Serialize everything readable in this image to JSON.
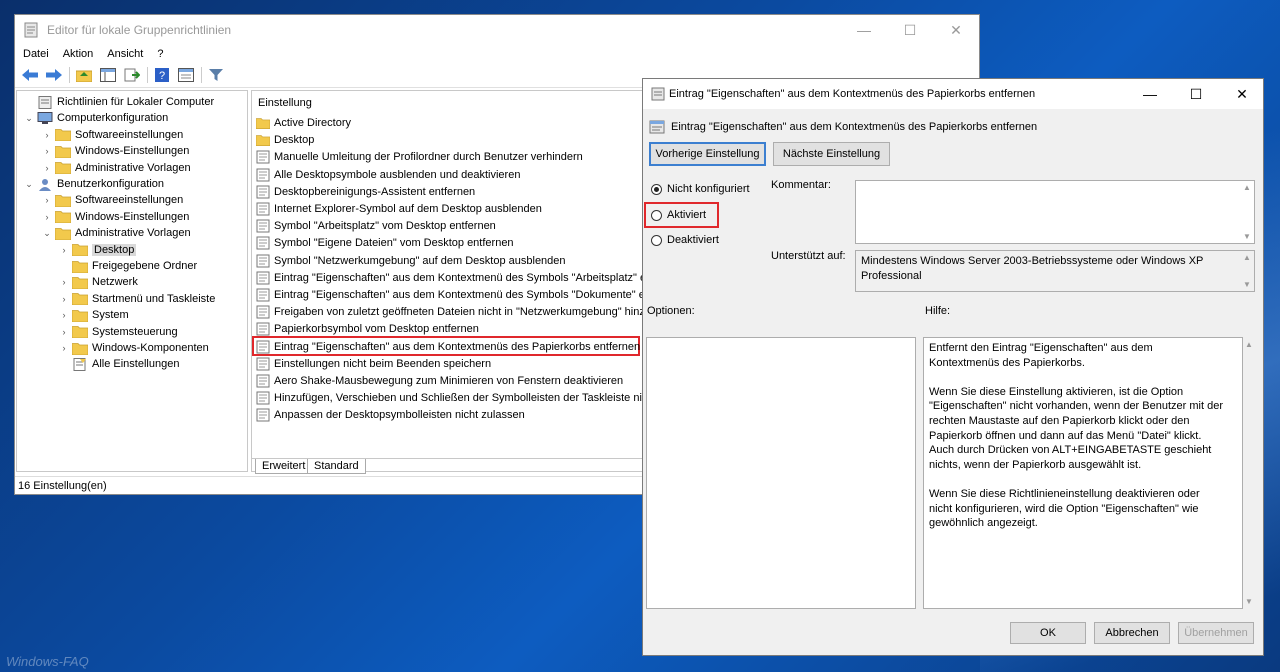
{
  "main_window": {
    "title": "Editor für lokale Gruppenrichtlinien",
    "menu": [
      "Datei",
      "Aktion",
      "Ansicht",
      "?"
    ],
    "tree": [
      {
        "label": "Richtlinien für Lokaler Computer",
        "level": 0,
        "arrow": "",
        "icon": "computer-policy"
      },
      {
        "label": "Computerkonfiguration",
        "level": 1,
        "arrow": "v",
        "icon": "computer"
      },
      {
        "label": "Softwareeinstellungen",
        "level": 2,
        "arrow": ">",
        "icon": "folder"
      },
      {
        "label": "Windows-Einstellungen",
        "level": 2,
        "arrow": ">",
        "icon": "folder"
      },
      {
        "label": "Administrative Vorlagen",
        "level": 2,
        "arrow": ">",
        "icon": "folder"
      },
      {
        "label": "Benutzerkonfiguration",
        "level": 1,
        "arrow": "v",
        "icon": "user"
      },
      {
        "label": "Softwareeinstellungen",
        "level": 2,
        "arrow": ">",
        "icon": "folder"
      },
      {
        "label": "Windows-Einstellungen",
        "level": 2,
        "arrow": ">",
        "icon": "folder"
      },
      {
        "label": "Administrative Vorlagen",
        "level": 2,
        "arrow": "v",
        "icon": "folder"
      },
      {
        "label": "Desktop",
        "level": 3,
        "arrow": ">",
        "icon": "folder",
        "selected": true
      },
      {
        "label": "Freigegebene Ordner",
        "level": 3,
        "arrow": "",
        "icon": "folder"
      },
      {
        "label": "Netzwerk",
        "level": 3,
        "arrow": ">",
        "icon": "folder"
      },
      {
        "label": "Startmenü und Taskleiste",
        "level": 3,
        "arrow": ">",
        "icon": "folder"
      },
      {
        "label": "System",
        "level": 3,
        "arrow": ">",
        "icon": "folder"
      },
      {
        "label": "Systemsteuerung",
        "level": 3,
        "arrow": ">",
        "icon": "folder"
      },
      {
        "label": "Windows-Komponenten",
        "level": 3,
        "arrow": ">",
        "icon": "folder"
      },
      {
        "label": "Alle Einstellungen",
        "level": 3,
        "arrow": "",
        "icon": "settings"
      }
    ],
    "list_header": "Einstellung",
    "list_items": [
      {
        "label": "Active Directory",
        "icon": "folder"
      },
      {
        "label": "Desktop",
        "icon": "folder"
      },
      {
        "label": "Manuelle Umleitung der Profilordner durch Benutzer verhindern",
        "icon": "setting"
      },
      {
        "label": "Alle Desktopsymbole ausblenden und deaktivieren",
        "icon": "setting"
      },
      {
        "label": "Desktopbereinigungs-Assistent entfernen",
        "icon": "setting"
      },
      {
        "label": "Internet Explorer-Symbol auf dem Desktop ausblenden",
        "icon": "setting"
      },
      {
        "label": "Symbol \"Arbeitsplatz\" vom Desktop entfernen",
        "icon": "setting"
      },
      {
        "label": "Symbol \"Eigene Dateien\" vom Desktop entfernen",
        "icon": "setting"
      },
      {
        "label": "Symbol \"Netzwerkumgebung\" auf dem Desktop ausblenden",
        "icon": "setting"
      },
      {
        "label": "Eintrag \"Eigenschaften\" aus dem Kontextmenü des Symbols \"Arbeitsplatz\" entfe",
        "icon": "setting"
      },
      {
        "label": "Eintrag \"Eigenschaften\" aus dem Kontextmenü des Symbols \"Dokumente\" entfe",
        "icon": "setting"
      },
      {
        "label": "Freigaben von zuletzt geöffneten Dateien nicht in \"Netzwerkumgebung\" hinzu",
        "icon": "setting"
      },
      {
        "label": "Papierkorbsymbol vom Desktop entfernen",
        "icon": "setting"
      },
      {
        "label": "Eintrag \"Eigenschaften\" aus dem Kontextmenüs des Papierkorbs entfernen",
        "icon": "setting",
        "selected": true
      },
      {
        "label": "Einstellungen nicht beim Beenden speichern",
        "icon": "setting"
      },
      {
        "label": "Aero Shake-Mausbewegung zum Minimieren von Fenstern deaktivieren",
        "icon": "setting"
      },
      {
        "label": "Hinzufügen, Verschieben und Schließen der Symbolleisten der Taskleiste nicht z",
        "icon": "setting"
      },
      {
        "label": "Anpassen der Desktopsymbolleisten nicht zulassen",
        "icon": "setting"
      }
    ],
    "tabs": [
      "Erweitert",
      "Standard"
    ],
    "status": "16 Einstellung(en)"
  },
  "dialog": {
    "title": "Eintrag \"Eigenschaften\" aus dem Kontextmenüs des Papierkorbs entfernen",
    "subtitle": "Eintrag \"Eigenschaften\" aus dem Kontextmenüs des Papierkorbs entfernen",
    "prev_button": "Vorherige Einstellung",
    "next_button": "Nächste Einstellung",
    "radio_not_configured": "Nicht konfiguriert",
    "radio_enabled": "Aktiviert",
    "radio_disabled": "Deaktiviert",
    "selected_state": "Nicht konfiguriert",
    "comment_label": "Kommentar:",
    "comment_value": "",
    "supported_label": "Unterstützt auf:",
    "supported_value": "Mindestens Windows Server 2003-Betriebssysteme oder Windows XP Professional",
    "options_label": "Optionen:",
    "help_label": "Hilfe:",
    "help_text": "Entfernt den Eintrag \"Eigenschaften\" aus dem Kontextmenüs des Papierkorbs.\n\nWenn Sie diese Einstellung aktivieren, ist die Option \"Eigenschaften\" nicht vorhanden, wenn der Benutzer mit der rechten Maustaste auf den Papierkorb klickt oder den Papierkorb öffnen und dann auf das Menü \"Datei\" klickt. Auch durch Drücken von ALT+EINGABETASTE geschieht nichts, wenn der Papierkorb ausgewählt ist.\n\nWenn Sie diese Richtlinieneinstellung deaktivieren oder nicht konfigurieren, wird die Option \"Eigenschaften\" wie gewöhnlich angezeigt.",
    "ok_button": "OK",
    "cancel_button": "Abbrechen",
    "apply_button": "Übernehmen"
  },
  "watermark": "Windows-FAQ",
  "colors": {
    "highlight": "#e0282c",
    "focus_border": "#3c7fd0",
    "folder": "#f2c94c"
  }
}
